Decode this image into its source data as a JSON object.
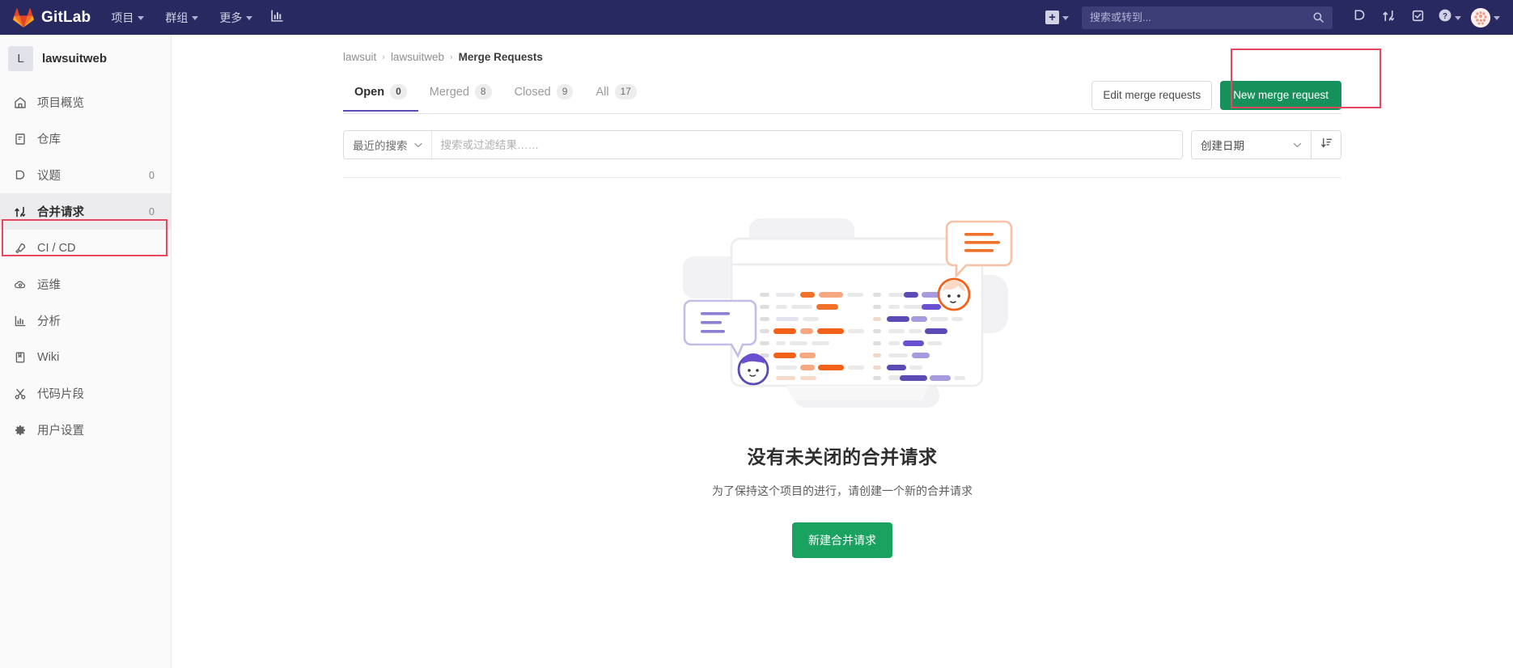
{
  "navbar": {
    "brand": "GitLab",
    "brand_logo_icon": "gitlab-tanuki-logo",
    "menu": [
      {
        "label": "项目",
        "icon": "chevron-down-icon"
      },
      {
        "label": "群组",
        "icon": "chevron-down-icon"
      },
      {
        "label": "更多",
        "icon": "chevron-down-icon"
      }
    ],
    "analytics_icon": "bar-chart-icon",
    "plus_icon": "plus-square-icon",
    "plus_chevron_icon": "chevron-down-icon",
    "search": {
      "placeholder": "搜索或转到...",
      "value": "",
      "icon": "search-icon"
    },
    "right_icons": [
      {
        "name": "issues-icon",
        "label": "议题"
      },
      {
        "name": "merge-request-icon",
        "label": "合并请求"
      },
      {
        "name": "todos-check-icon",
        "label": "待办事项"
      }
    ],
    "help_icon": "question-circle-icon",
    "help_chevron_icon": "chevron-down-icon",
    "avatar_icon": "user-avatar-identicon",
    "avatar_chevron_icon": "chevron-down-icon",
    "colors": {
      "background": "#292961",
      "search_bg": "#3d3d77",
      "text": "#d2d2e6"
    }
  },
  "sidebar": {
    "project_initial": "L",
    "project_name": "lawsuitweb",
    "items": [
      {
        "label": "项目概览",
        "icon": "home-icon",
        "count": "",
        "active": false
      },
      {
        "label": "仓库",
        "icon": "repository-icon",
        "count": "",
        "active": false
      },
      {
        "label": "议题",
        "icon": "issues-icon",
        "count": "0",
        "active": false
      },
      {
        "label": "合并请求",
        "icon": "merge-request-icon",
        "count": "0",
        "active": true
      },
      {
        "label": "CI / CD",
        "icon": "rocket-icon",
        "count": "",
        "active": false
      },
      {
        "label": "运维",
        "icon": "cloud-gear-icon",
        "count": "",
        "active": false
      },
      {
        "label": "分析",
        "icon": "bar-chart-icon",
        "count": "",
        "active": false
      },
      {
        "label": "Wiki",
        "icon": "book-icon",
        "count": "",
        "active": false
      },
      {
        "label": "代码片段",
        "icon": "scissors-icon",
        "count": "",
        "active": false
      },
      {
        "label": "用户设置",
        "icon": "gear-icon",
        "count": "",
        "active": false
      }
    ]
  },
  "breadcrumb": {
    "group": "lawsuit",
    "project": "lawsuitweb",
    "current": "Merge Requests",
    "separator": "›"
  },
  "tabs": [
    {
      "label": "Open",
      "count": "0",
      "active": true
    },
    {
      "label": "Merged",
      "count": "8",
      "active": false
    },
    {
      "label": "Closed",
      "count": "9",
      "active": false
    },
    {
      "label": "All",
      "count": "17",
      "active": false
    }
  ],
  "actions": {
    "edit_label": "Edit merge requests",
    "new_label": "New merge request",
    "new_button_color": "#16915b"
  },
  "filter": {
    "recent_searches_label": "最近的搜索",
    "recent_chevron_icon": "chevron-down-icon",
    "placeholder": "搜索或过滤结果……",
    "value": "",
    "sort_value": "创建日期",
    "sort_chevron_icon": "chevron-down-icon",
    "sort_direction_icon": "sort-descending-icon"
  },
  "empty_state": {
    "illustration": "merge-request-empty-illustration",
    "title": "没有未关闭的合并请求",
    "subtitle": "为了保持这个项目的进行，请创建一个新的合并请求",
    "button_label": "新建合并请求",
    "button_color": "#1aa260"
  },
  "annotations": {
    "color": "#e8485f",
    "boxes": [
      {
        "name": "sidebar-merge-requests-highlight"
      },
      {
        "name": "new-merge-request-highlight"
      }
    ]
  }
}
